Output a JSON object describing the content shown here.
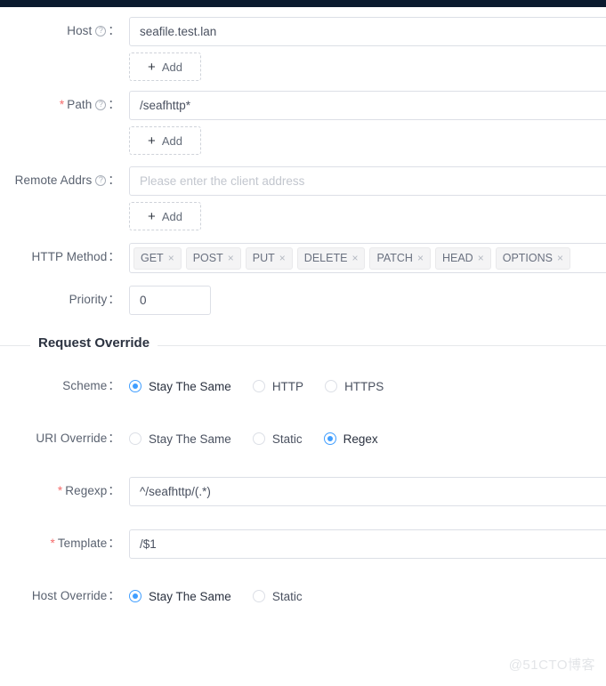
{
  "window": {
    "topbar_color": "#0b1a2e",
    "accent_color": "#409eff",
    "required_color": "#f56c6c"
  },
  "form": {
    "fields": [
      {
        "key": "host",
        "label": "Host",
        "required": false,
        "help_icon": "question-circle-icon",
        "colon": "：",
        "value": "seafile.test.lan",
        "placeholder": "",
        "add_label": "Add",
        "add_icon": "plus-icon"
      },
      {
        "key": "path",
        "label": "Path",
        "required": true,
        "required_mark": "*",
        "help_icon": "question-circle-icon",
        "colon": "：",
        "value": "/seafhttp*",
        "placeholder": "",
        "add_label": "Add",
        "add_icon": "plus-icon"
      },
      {
        "key": "remote_addrs",
        "label": "Remote Addrs",
        "required": false,
        "help_icon": "question-circle-icon",
        "colon": "：",
        "value": "",
        "placeholder": "Please enter the client address",
        "add_label": "Add",
        "add_icon": "plus-icon"
      }
    ],
    "http_method": {
      "label": "HTTP Method",
      "colon": "：",
      "tags": [
        "GET",
        "POST",
        "PUT",
        "DELETE",
        "PATCH",
        "HEAD",
        "OPTIONS"
      ],
      "remove_icon": "close-icon",
      "remove_glyph": "×"
    },
    "priority": {
      "label": "Priority",
      "colon": "：",
      "value": "0"
    }
  },
  "request_override": {
    "section_title": "Request Override",
    "scheme": {
      "label": "Scheme",
      "colon": "：",
      "options": [
        "Stay The Same",
        "HTTP",
        "HTTPS"
      ],
      "selected": "Stay The Same"
    },
    "uri_override": {
      "label": "URI Override",
      "colon": "：",
      "options": [
        "Stay The Same",
        "Static",
        "Regex"
      ],
      "selected": "Regex"
    },
    "regexp": {
      "label": "Regexp",
      "required_mark": "*",
      "colon": "：",
      "value": "^/seafhttp/(.*)"
    },
    "template": {
      "label": "Template",
      "required_mark": "*",
      "colon": "：",
      "value": "/$1"
    },
    "host_override": {
      "label": "Host Override",
      "colon": "：",
      "options": [
        "Stay The Same",
        "Static"
      ],
      "selected": "Stay The Same"
    }
  },
  "watermark": "@51CTO博客"
}
